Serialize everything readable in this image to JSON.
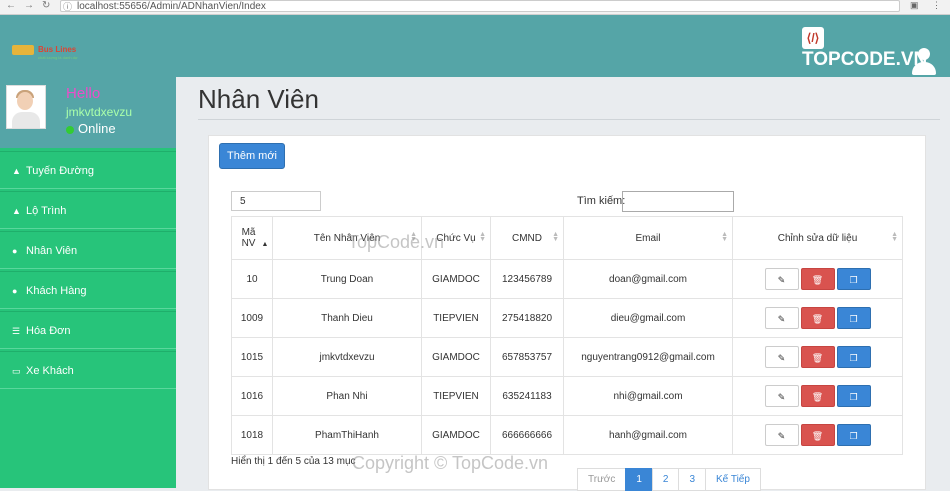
{
  "browser": {
    "url": "localhost:55656/Admin/ADNhanVien/Index"
  },
  "brand": {
    "logo_text": "Bus Lines",
    "logo_sub": "chất lượng là danh dự",
    "topcode": "TOPCODE.VN"
  },
  "profile": {
    "greeting": "Hello",
    "username": "jmkvtdxevzu",
    "status": "Online"
  },
  "sidebar": {
    "items": [
      {
        "label": "Tuyến Đường",
        "icon": "road-icon"
      },
      {
        "label": "Lộ Trình",
        "icon": "road-icon"
      },
      {
        "label": "Nhân Viên",
        "icon": "user-icon"
      },
      {
        "label": "Khách Hàng",
        "icon": "user-icon"
      },
      {
        "label": "Hóa Đơn",
        "icon": "list-icon"
      },
      {
        "label": "Xe Khách",
        "icon": "card-icon"
      }
    ]
  },
  "page": {
    "title": "Nhân Viên",
    "add_label": "Thêm mới"
  },
  "table_controls": {
    "page_length": "5",
    "search_label": "Tìm kiếm:"
  },
  "table": {
    "headers": [
      "Mã NV",
      "Tên Nhân Viên",
      "Chức Vụ",
      "CMND",
      "Email",
      "Chỉnh sửa dữ liệu"
    ],
    "rows": [
      [
        "10",
        "Trung Doan",
        "GIAMDOC",
        "123456789",
        "doan@gmail.com"
      ],
      [
        "1009",
        "Thanh Dieu",
        "TIEPVIEN",
        "275418820",
        "dieu@gmail.com"
      ],
      [
        "1015",
        "jmkvtdxevzu",
        "GIAMDOC",
        "657853757",
        "nguyentrang0912@gmail.com"
      ],
      [
        "1016",
        "Phan Nhi",
        "TIEPVIEN",
        "635241183",
        "nhi@gmail.com"
      ],
      [
        "1018",
        "PhamThiHanh",
        "GIAMDOC",
        "666666666",
        "hanh@gmail.com"
      ]
    ]
  },
  "info_text": "Hiển thị 1 đến 5 của 13 mục",
  "pagination": {
    "prev": "Trước",
    "pages": [
      "1",
      "2",
      "3"
    ],
    "next": "Kế Tiếp",
    "active": "1"
  },
  "watermarks": {
    "mid": "TopCode.vn",
    "bottom": "Copyright © TopCode.vn"
  }
}
